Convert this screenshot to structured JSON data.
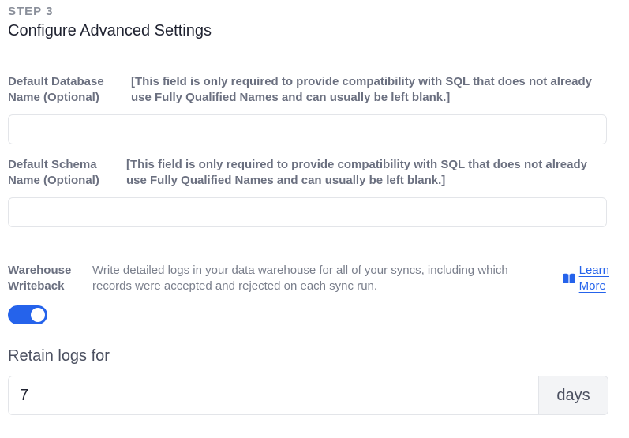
{
  "step": {
    "label": "STEP 3",
    "title": "Configure Advanced Settings"
  },
  "fields": {
    "database": {
      "label_line1": "Default Database",
      "label_line2": "Name (Optional)",
      "note": "[This field is only required to provide compatibility with SQL that does not already use Fully Qualified Names and can usually be left blank.]",
      "value": "",
      "placeholder": ""
    },
    "schema": {
      "label_line1": "Default Schema",
      "label_line2": "Name (Optional)",
      "note": "[This field is only required to provide compatibility with SQL that does not already use Fully Qualified Names and can usually be left blank.]",
      "value": "",
      "placeholder": ""
    }
  },
  "writeback": {
    "label_line1": "Warehouse",
    "label_line2": "Writeback",
    "description": "Write detailed logs in your data warehouse for all of your syncs, including which records were accepted and rejected on each sync run.",
    "learn_more_line1": "Learn",
    "learn_more_line2": "More",
    "learn_more_icon": "book-icon",
    "enabled": true
  },
  "retain": {
    "label": "Retain logs for",
    "value": "7",
    "unit": "days"
  },
  "colors": {
    "accent": "#2563eb",
    "muted_text": "#6b7080",
    "border": "#e3e5e9"
  }
}
